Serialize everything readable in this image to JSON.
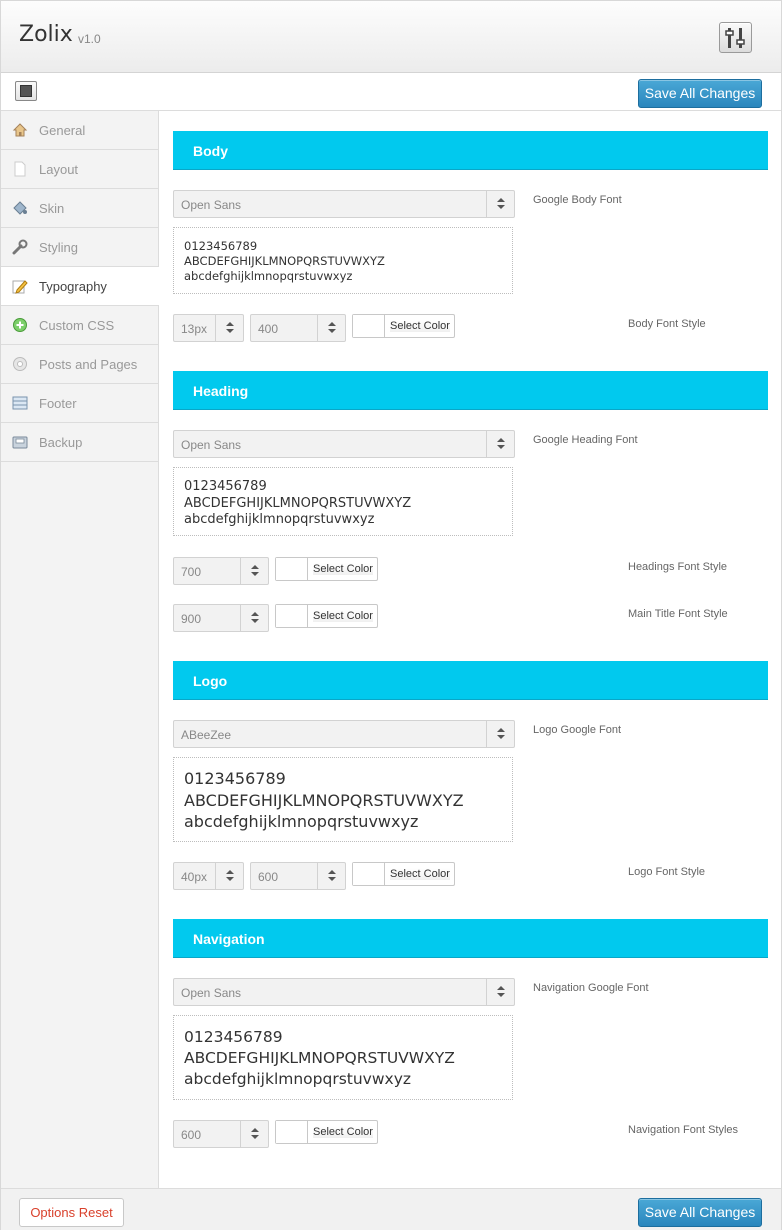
{
  "app": {
    "title": "Zolix",
    "version": "v1.0"
  },
  "toolbar": {
    "save_label": "Save All Changes"
  },
  "footer": {
    "reset_label": "Options Reset",
    "save_label": "Save All Changes"
  },
  "sidebar": {
    "active": "Typography",
    "items": [
      {
        "label": "General",
        "icon": "home-icon"
      },
      {
        "label": "Layout",
        "icon": "page-icon"
      },
      {
        "label": "Skin",
        "icon": "paint-bucket-icon"
      },
      {
        "label": "Styling",
        "icon": "wrench-icon"
      },
      {
        "label": "Typography",
        "icon": "pencil-icon"
      },
      {
        "label": "Custom CSS",
        "icon": "plus-circle-icon"
      },
      {
        "label": "Posts and Pages",
        "icon": "pages-icon"
      },
      {
        "label": "Footer",
        "icon": "footer-icon"
      },
      {
        "label": "Backup",
        "icon": "backup-icon"
      }
    ]
  },
  "preview_text": {
    "digits": "0123456789",
    "upper": "ABCDEFGHIJKLMNOPQRSTUVWXYZ",
    "lower": "abcdefghijklmnopqrstuvwxyz"
  },
  "sections": {
    "body": {
      "title": "Body",
      "font": "Open Sans",
      "font_label": "Google Body Font",
      "size": "13px",
      "weight": "400",
      "color_label": "Select Color",
      "style_label": "Body Font Style"
    },
    "heading": {
      "title": "Heading",
      "font": "Open Sans",
      "font_label": "Google Heading Font",
      "weight": "700",
      "color_label": "Select Color",
      "style_label": "Headings Font Style",
      "main_title_weight": "900",
      "main_title_color_label": "Select Color",
      "main_title_label": "Main Title Font Style"
    },
    "logo": {
      "title": "Logo",
      "font": "ABeeZee",
      "font_label": "Logo Google Font",
      "size": "40px",
      "weight": "600",
      "color_label": "Select Color",
      "style_label": "Logo Font Style"
    },
    "navigation": {
      "title": "Navigation",
      "font": "Open Sans",
      "font_label": "Navigation Google Font",
      "weight": "600",
      "color_label": "Select Color",
      "style_label": "Navigation Font Styles"
    }
  },
  "colors": {
    "accent": "#01c9ee",
    "button": "#2a86bd",
    "reset_text": "#d9412c"
  }
}
